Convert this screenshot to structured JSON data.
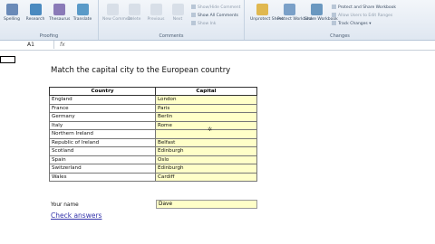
{
  "ribbon": {
    "proofing": {
      "label": "Proofing",
      "buttons": [
        {
          "label": "Spelling",
          "icon": "spelling-icon",
          "color": "#6a8ab8"
        },
        {
          "label": "Research",
          "icon": "research-icon",
          "color": "#4a8ac0"
        },
        {
          "label": "Thesaurus",
          "icon": "thesaurus-icon",
          "color": "#8a7ab8"
        },
        {
          "label": "Translate",
          "icon": "translate-icon",
          "color": "#5a9ac8"
        }
      ]
    },
    "comments": {
      "label": "Comments",
      "buttons": [
        {
          "label": "New Comment",
          "icon": "new-comment-icon"
        },
        {
          "label": "Delete",
          "icon": "delete-icon"
        },
        {
          "label": "Previous",
          "icon": "previous-icon"
        },
        {
          "label": "Next",
          "icon": "next-icon"
        }
      ],
      "items": [
        "Show/Hide Comment",
        "Show All Comments",
        "Show Ink"
      ]
    },
    "changes": {
      "label": "Changes",
      "buttons": [
        {
          "label": "Unprotect Sheet",
          "icon": "unprotect-sheet-icon"
        },
        {
          "label": "Protect Workbook",
          "icon": "protect-workbook-icon"
        },
        {
          "label": "Share Workbook",
          "icon": "share-workbook-icon"
        }
      ],
      "items": [
        "Protect and Share Workbook",
        "Allow Users to Edit Ranges",
        "Track Changes"
      ]
    }
  },
  "formula_bar": {
    "name_box": "A1",
    "fx": "fx"
  },
  "sheet": {
    "title": "Match the capital city to the European country",
    "headers": {
      "country": "Country",
      "capital": "Capital"
    },
    "rows": [
      {
        "country": "England",
        "capital": "London"
      },
      {
        "country": "France",
        "capital": "Paris"
      },
      {
        "country": "Germany",
        "capital": "Berlin"
      },
      {
        "country": "Italy",
        "capital": "Rome"
      },
      {
        "country": "Northern Ireland",
        "capital": ""
      },
      {
        "country": "Republic of Ireland",
        "capital": "Belfast"
      },
      {
        "country": "Scotland",
        "capital": "Edinburgh"
      },
      {
        "country": "Spain",
        "capital": "Oslo"
      },
      {
        "country": "Switzerland",
        "capital": "Edinburgh"
      },
      {
        "country": "Wales",
        "capital": "Cardiff"
      }
    ],
    "your_name_label": "Your name",
    "your_name_value": "Dave",
    "check_link": "Check answers"
  }
}
